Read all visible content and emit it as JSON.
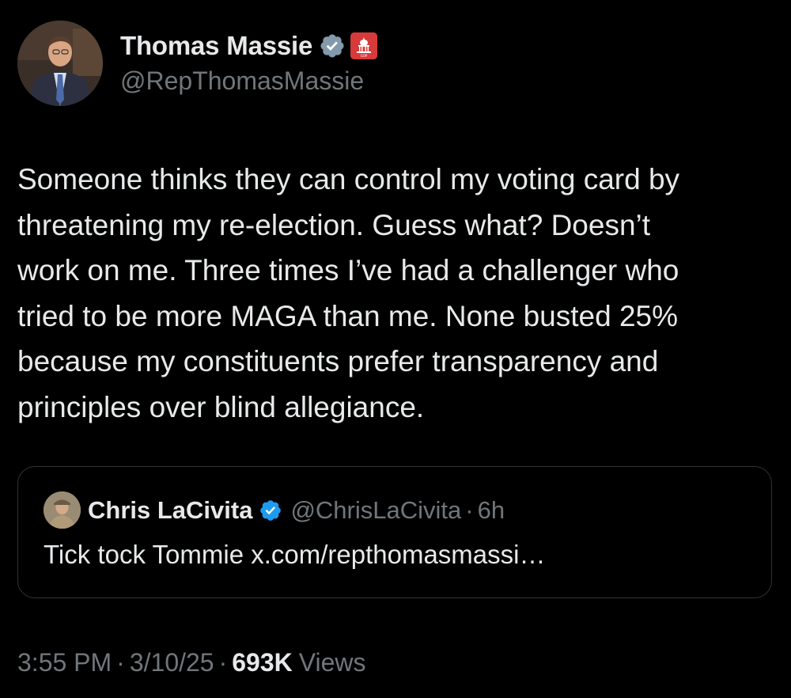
{
  "author": {
    "name": "Thomas Massie",
    "handle": "@RepThomasMassie",
    "avatar_icon": "profile-photo",
    "verified_icon": "verified-badge-icon",
    "affiliation_icon": "us-capitol-badge-icon"
  },
  "tweet": {
    "text": "Someone thinks they can control my voting card by\nthreatening my re-election. Guess what? Doesn’t\nwork on me. Three times I’ve had a challenger who\ntried to be more MAGA than me. None busted 25%\nbecause my constituents prefer transparency and\nprinciples over blind allegiance."
  },
  "quote": {
    "name": "Chris LaCivita",
    "handle": "@ChrisLaCivita",
    "separator": "·",
    "time": "6h",
    "text": "Tick tock Tommie x.com/repthomasmassi…",
    "verified_icon": "verified-badge-icon"
  },
  "meta": {
    "time": "3:55 PM",
    "separator": "·",
    "date": "3/10/25",
    "views_count": "693K",
    "views_label": "Views"
  },
  "colors": {
    "background": "#000000",
    "text_primary": "#e7e9ea",
    "text_secondary": "#71767b",
    "border": "#2f3336",
    "verified_blue": "#1d9bf0",
    "gov_badge_red": "#d63a3a",
    "gov_verified_gray": "#829aab"
  }
}
